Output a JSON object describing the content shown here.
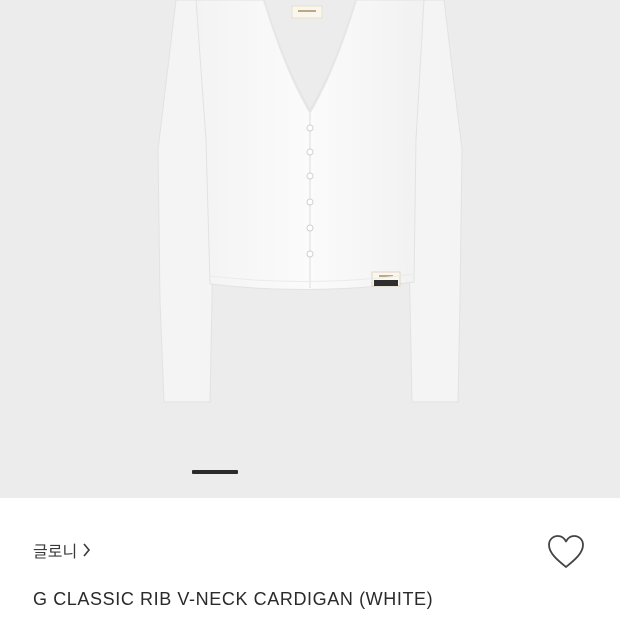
{
  "product": {
    "brand": "글로니",
    "title": "G CLASSIC RIB V-NECK CARDIGAN (WHITE)"
  },
  "gallery": {
    "image_label": "white cardigan product photo",
    "active_index": 1,
    "background": "#ececec"
  },
  "icons": {
    "brand_chevron": "chevron-right-icon",
    "wishlist": "heart-outline-icon"
  }
}
